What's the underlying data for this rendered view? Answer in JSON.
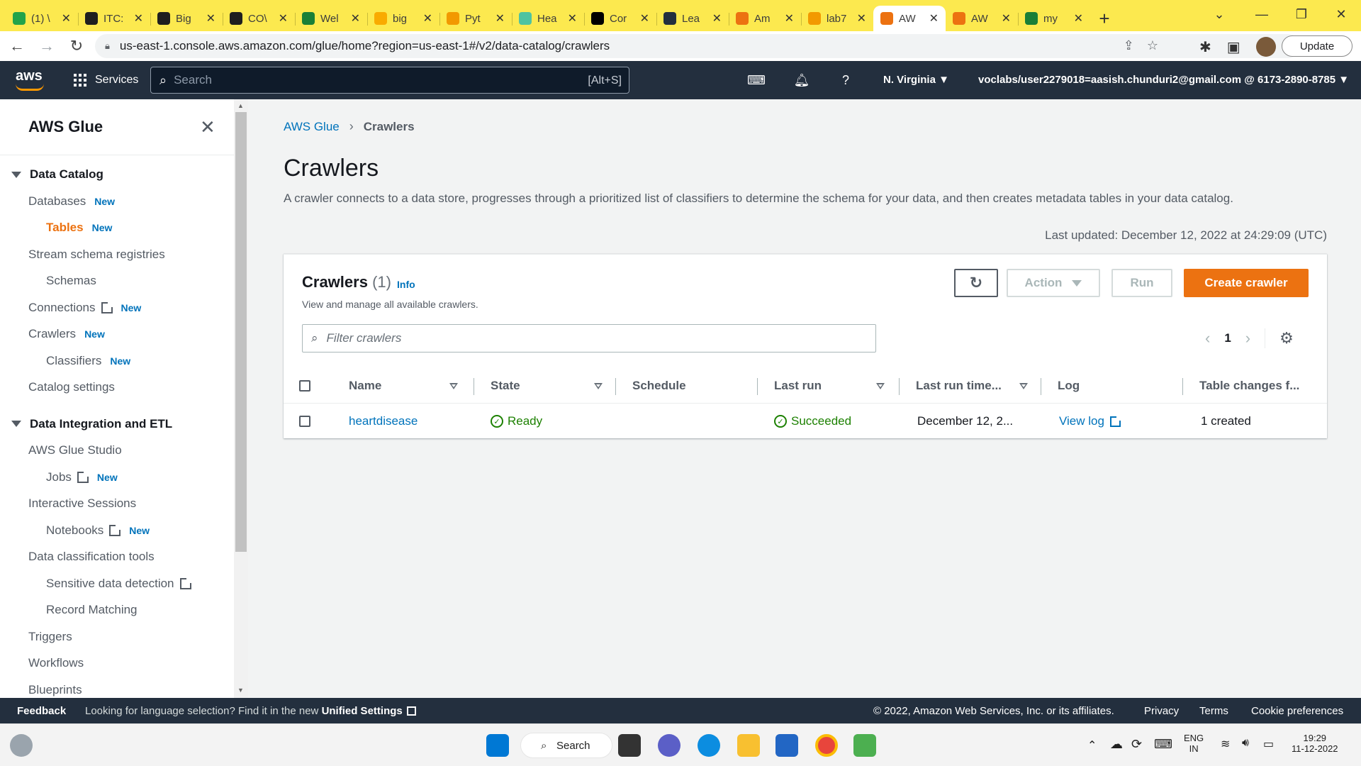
{
  "browser": {
    "tabs": [
      {
        "title": "(1) \\",
        "icon_color": "#22a34a",
        "icon": "1"
      },
      {
        "title": "ITC:",
        "icon_color": "#1f1f1f",
        "icon": "gh"
      },
      {
        "title": "Big",
        "icon_color": "#1f1f1f",
        "icon": "gh"
      },
      {
        "title": "CO\\",
        "icon_color": "#1f1f1f",
        "icon": "gh"
      },
      {
        "title": "Wel",
        "icon_color": "#1a7f37",
        "icon": "G"
      },
      {
        "title": "big",
        "icon_color": "#f9ab00",
        "icon": "co"
      },
      {
        "title": "Pyt",
        "icon_color": "#f29900",
        "icon": "py"
      },
      {
        "title": "Hea",
        "icon_color": "#4fc3a1",
        "icon": "+"
      },
      {
        "title": "Cor",
        "icon_color": "#000000",
        "icon": "M"
      },
      {
        "title": "Lea",
        "icon_color": "#232f3e",
        "icon": "aws"
      },
      {
        "title": "Am",
        "icon_color": "#ec7211",
        "icon": "cube"
      },
      {
        "title": "lab7",
        "icon_color": "#f29900",
        "icon": "o"
      },
      {
        "title": "AW",
        "icon_color": "#ec7211",
        "icon": "cube",
        "active": true
      },
      {
        "title": "AW",
        "icon_color": "#ec7211",
        "icon": "cube"
      },
      {
        "title": "my",
        "icon_color": "#1a7f37",
        "icon": "G"
      }
    ],
    "url": "us-east-1.console.aws.amazon.com/glue/home?region=us-east-1#/v2/data-catalog/crawlers",
    "update_label": "Update"
  },
  "awsnav": {
    "logo": "aws",
    "services_label": "Services",
    "search_placeholder": "Search",
    "search_shortcut": "[Alt+S]",
    "region": "N. Virginia ▼",
    "account": "voclabs/user2279018=aasish.chunduri2@gmail.com @ 6173-2890-8785 ▼"
  },
  "sidebar": {
    "title": "AWS Glue",
    "items": [
      {
        "label": "Data Catalog",
        "type": "section"
      },
      {
        "label": "Databases",
        "new": "New"
      },
      {
        "label": "Tables",
        "new": "New",
        "current": true
      },
      {
        "label": "Stream schema registries"
      },
      {
        "label": "Schemas"
      },
      {
        "label": "Connections",
        "new": "New",
        "external": true
      },
      {
        "label": "Crawlers",
        "new": "New"
      },
      {
        "label": "Classifiers",
        "new": "New"
      },
      {
        "label": "Catalog settings"
      },
      {
        "label": "Data Integration and ETL",
        "type": "section"
      },
      {
        "label": "AWS Glue Studio"
      },
      {
        "label": "Jobs",
        "new": "New",
        "external": true
      },
      {
        "label": "Interactive Sessions"
      },
      {
        "label": "Notebooks",
        "new": "New",
        "external": true
      },
      {
        "label": "Data classification tools"
      },
      {
        "label": "Sensitive data detection",
        "external": true
      },
      {
        "label": "Record Matching"
      },
      {
        "label": "Triggers"
      },
      {
        "label": "Workflows"
      },
      {
        "label": "Blueprints"
      }
    ]
  },
  "main": {
    "breadcrumb": {
      "root": "AWS Glue",
      "current": "Crawlers"
    },
    "title": "Crawlers",
    "description": "A crawler connects to a data store, progresses through a prioritized list of classifiers to determine the schema for your data, and then creates metadata tables in your data catalog.",
    "last_updated": "Last updated: December 12, 2022 at 24:29:09 (UTC)",
    "panel": {
      "title": "Crawlers",
      "count": "(1)",
      "info": "Info",
      "subtitle": "View and manage all available crawlers.",
      "action_label": "Action",
      "run_label": "Run",
      "create_label": "Create crawler",
      "filter_placeholder": "Filter crawlers",
      "page": "1"
    },
    "columns": [
      "Name",
      "State",
      "Schedule",
      "Last run",
      "Last run time...",
      "Log",
      "Table changes f..."
    ],
    "rows": [
      {
        "name": "heartdisease",
        "state": "Ready",
        "schedule": "",
        "last_run": "Succeeded",
        "last_run_time": "December 12, 2...",
        "log": "View log",
        "table_changes": "1 created"
      }
    ]
  },
  "footer": {
    "feedback": "Feedback",
    "lang_message": "Looking for language selection? Find it in the new",
    "lang_link": "Unified Settings",
    "copyright": "© 2022, Amazon Web Services, Inc. or its affiliates.",
    "privacy": "Privacy",
    "terms": "Terms",
    "cookies": "Cookie preferences"
  },
  "taskbar": {
    "search_label": "Search",
    "lang": "ENG",
    "region": "IN",
    "time": "19:29",
    "date": "11-12-2022"
  }
}
